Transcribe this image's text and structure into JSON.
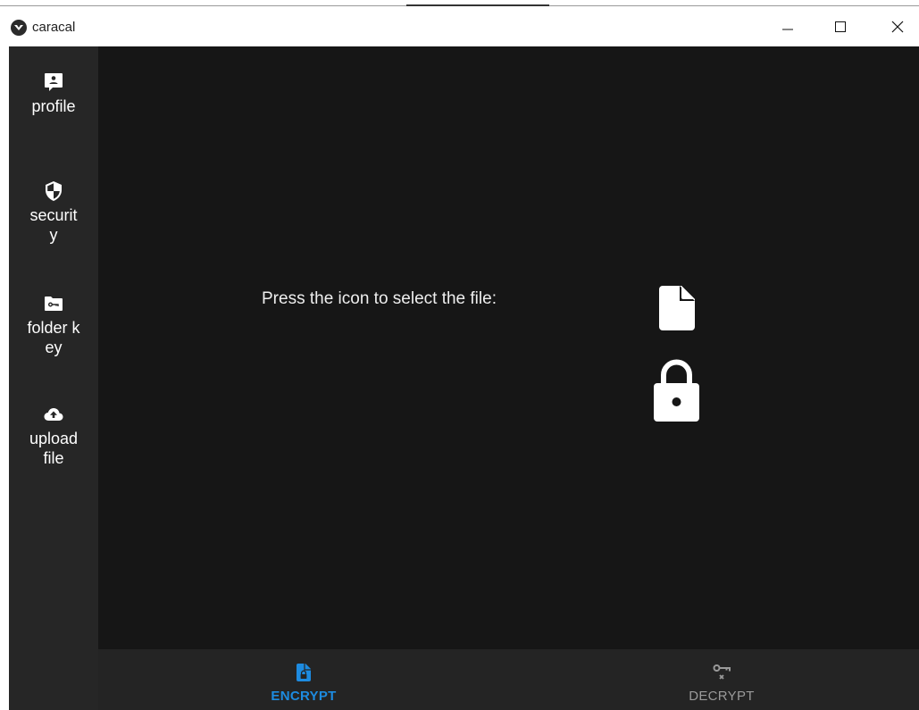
{
  "window": {
    "title": "caracal",
    "controls": {
      "minimize": "—",
      "maximize": "☐",
      "close": "✕"
    }
  },
  "sidebar": {
    "items": [
      {
        "label": "profile",
        "icon": "account-box-icon"
      },
      {
        "label": "security",
        "icon": "shield-icon"
      },
      {
        "label": "folder key",
        "icon": "folder-key-icon"
      },
      {
        "label": "upload file",
        "icon": "cloud-upload-icon"
      }
    ]
  },
  "main": {
    "prompt": "Press the icon to select the file:",
    "file_icon": "file-icon",
    "lock_icon": "lock-icon"
  },
  "bottom_nav": {
    "tabs": [
      {
        "label": "ENCRYPT",
        "icon": "file-lock-icon",
        "active": true,
        "color": "#1d8be0"
      },
      {
        "label": "DECRYPT",
        "icon": "key-remove-icon",
        "active": false,
        "color": "#9a9a9a"
      }
    ]
  },
  "colors": {
    "sidebar_bg": "#262626",
    "main_bg": "#161616",
    "nav_bg": "#242424",
    "accent": "#1d8be0"
  }
}
